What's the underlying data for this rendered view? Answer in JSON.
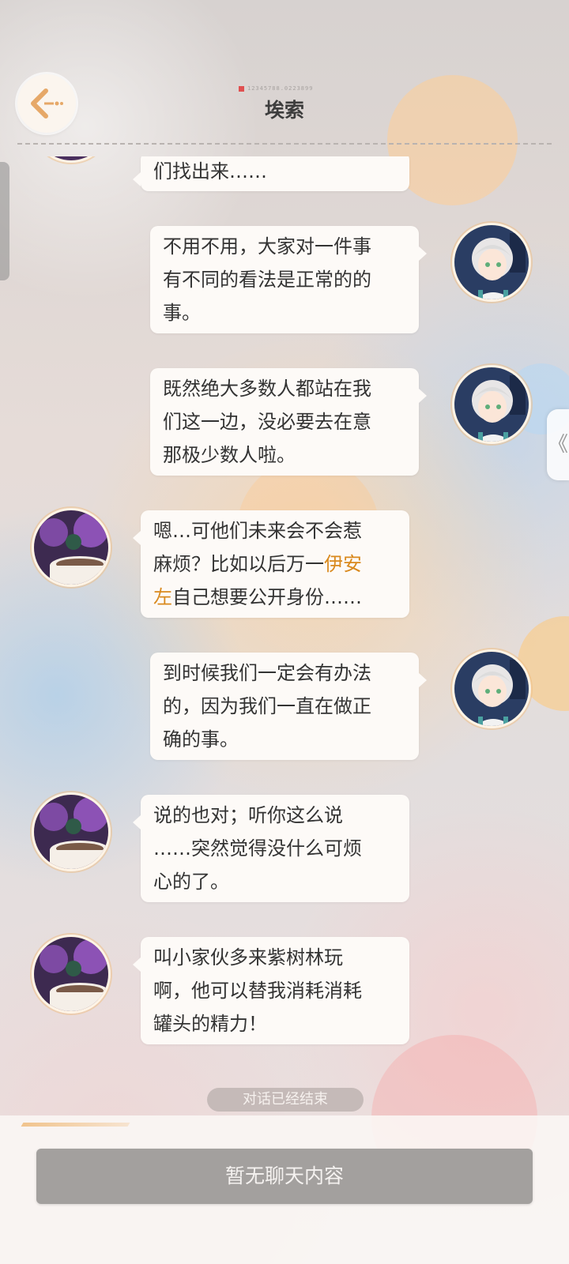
{
  "header": {
    "title": "埃索",
    "device_id": "12345788.0223899"
  },
  "messages": [
    {
      "side": "left",
      "sender": "lilac",
      "lines": [
        "们找出来……"
      ]
    },
    {
      "side": "right",
      "sender": "boy",
      "lines": [
        "不用不用，大家对一件事",
        "有不同的看法是正常的的",
        "事。"
      ]
    },
    {
      "side": "right",
      "sender": "boy",
      "lines": [
        "既然绝大多数人都站在我",
        "们这一边，没必要去在意",
        "那极少数人啦。"
      ]
    },
    {
      "side": "left",
      "sender": "lilac",
      "lines": [
        "嗯…可他们未来会不会惹",
        "麻烦？比如以后万一",
        "自己想要公开身份……"
      ],
      "highlight_name": "伊安左",
      "highlight_parts": [
        "伊安",
        "左"
      ]
    },
    {
      "side": "right",
      "sender": "boy",
      "lines": [
        "到时候我们一定会有办法",
        "的，因为我们一直在做正",
        "确的事。"
      ]
    },
    {
      "side": "left",
      "sender": "lilac",
      "lines": [
        "说的也对；听你这么说",
        "……突然觉得没什么可烦",
        "心的了。"
      ]
    },
    {
      "side": "left",
      "sender": "lilac",
      "lines": [
        "叫小家伙多来紫树林玩",
        "啊，他可以替我消耗消耗",
        "罐头的精力！"
      ]
    }
  ],
  "status": {
    "conversation_ended": "对话已经结束"
  },
  "footer": {
    "no_chat_label": "暂无聊天内容"
  },
  "side_tab": {
    "glyph": "《"
  },
  "colors": {
    "highlight": "#d9891d",
    "bubble": "#fdfaf7",
    "button": "#a3a09e"
  },
  "icons": {
    "back": "back-arrow-icon",
    "side_tab": "collapse-chevron-icon"
  }
}
